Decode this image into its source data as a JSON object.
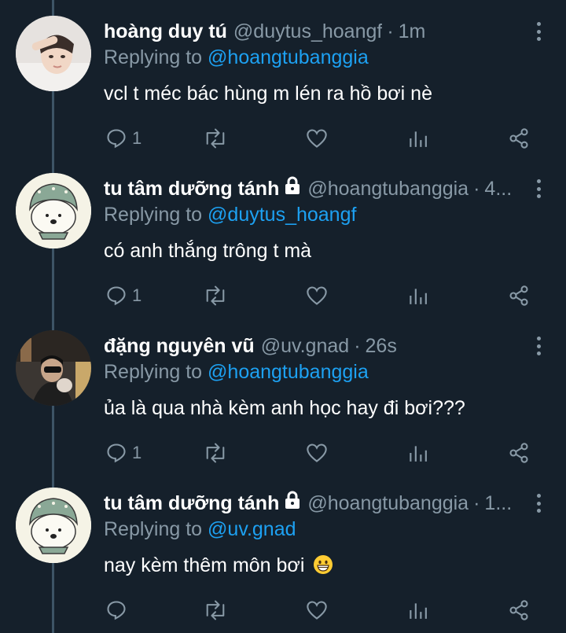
{
  "replying_to_label": "Replying to",
  "tweets": [
    {
      "name": "hoàng duy tú",
      "locked": false,
      "handle": "@duytus_hoangf",
      "time": "1m",
      "reply_to": "@hoangtubanggia",
      "text": "vcl t méc bác hùng m lén ra hồ bơi nè",
      "reply_count": "1",
      "avatar": "photo-avatar"
    },
    {
      "name": "tu tâm dưỡng tánh",
      "locked": true,
      "handle": "@hoangtubanggia",
      "time": "4...",
      "reply_to": "@duytus_hoangf",
      "text": "có anh thắng trông t mà",
      "reply_count": "1",
      "avatar": "bear-avatar"
    },
    {
      "name": "đặng nguyên vũ",
      "locked": false,
      "handle": "@uv.gnad",
      "time": "26s",
      "reply_to": "@hoangtubanggia",
      "text": "ủa là qua nhà kèm anh học hay đi bơi???",
      "reply_count": "1",
      "avatar": "photo-avatar-2"
    },
    {
      "name": "tu tâm dưỡng tánh",
      "locked": true,
      "handle": "@hoangtubanggia",
      "time": "1...",
      "reply_to": "@uv.gnad",
      "text": "nay kèm thêm môn bơi",
      "text_emoji": "grinning-face-emoji",
      "reply_count": "",
      "avatar": "bear-avatar"
    }
  ],
  "colors": {
    "background": "#15202b",
    "secondary_text": "#8899a6",
    "mention": "#1da1f2",
    "thread_line": "#3d5466"
  }
}
